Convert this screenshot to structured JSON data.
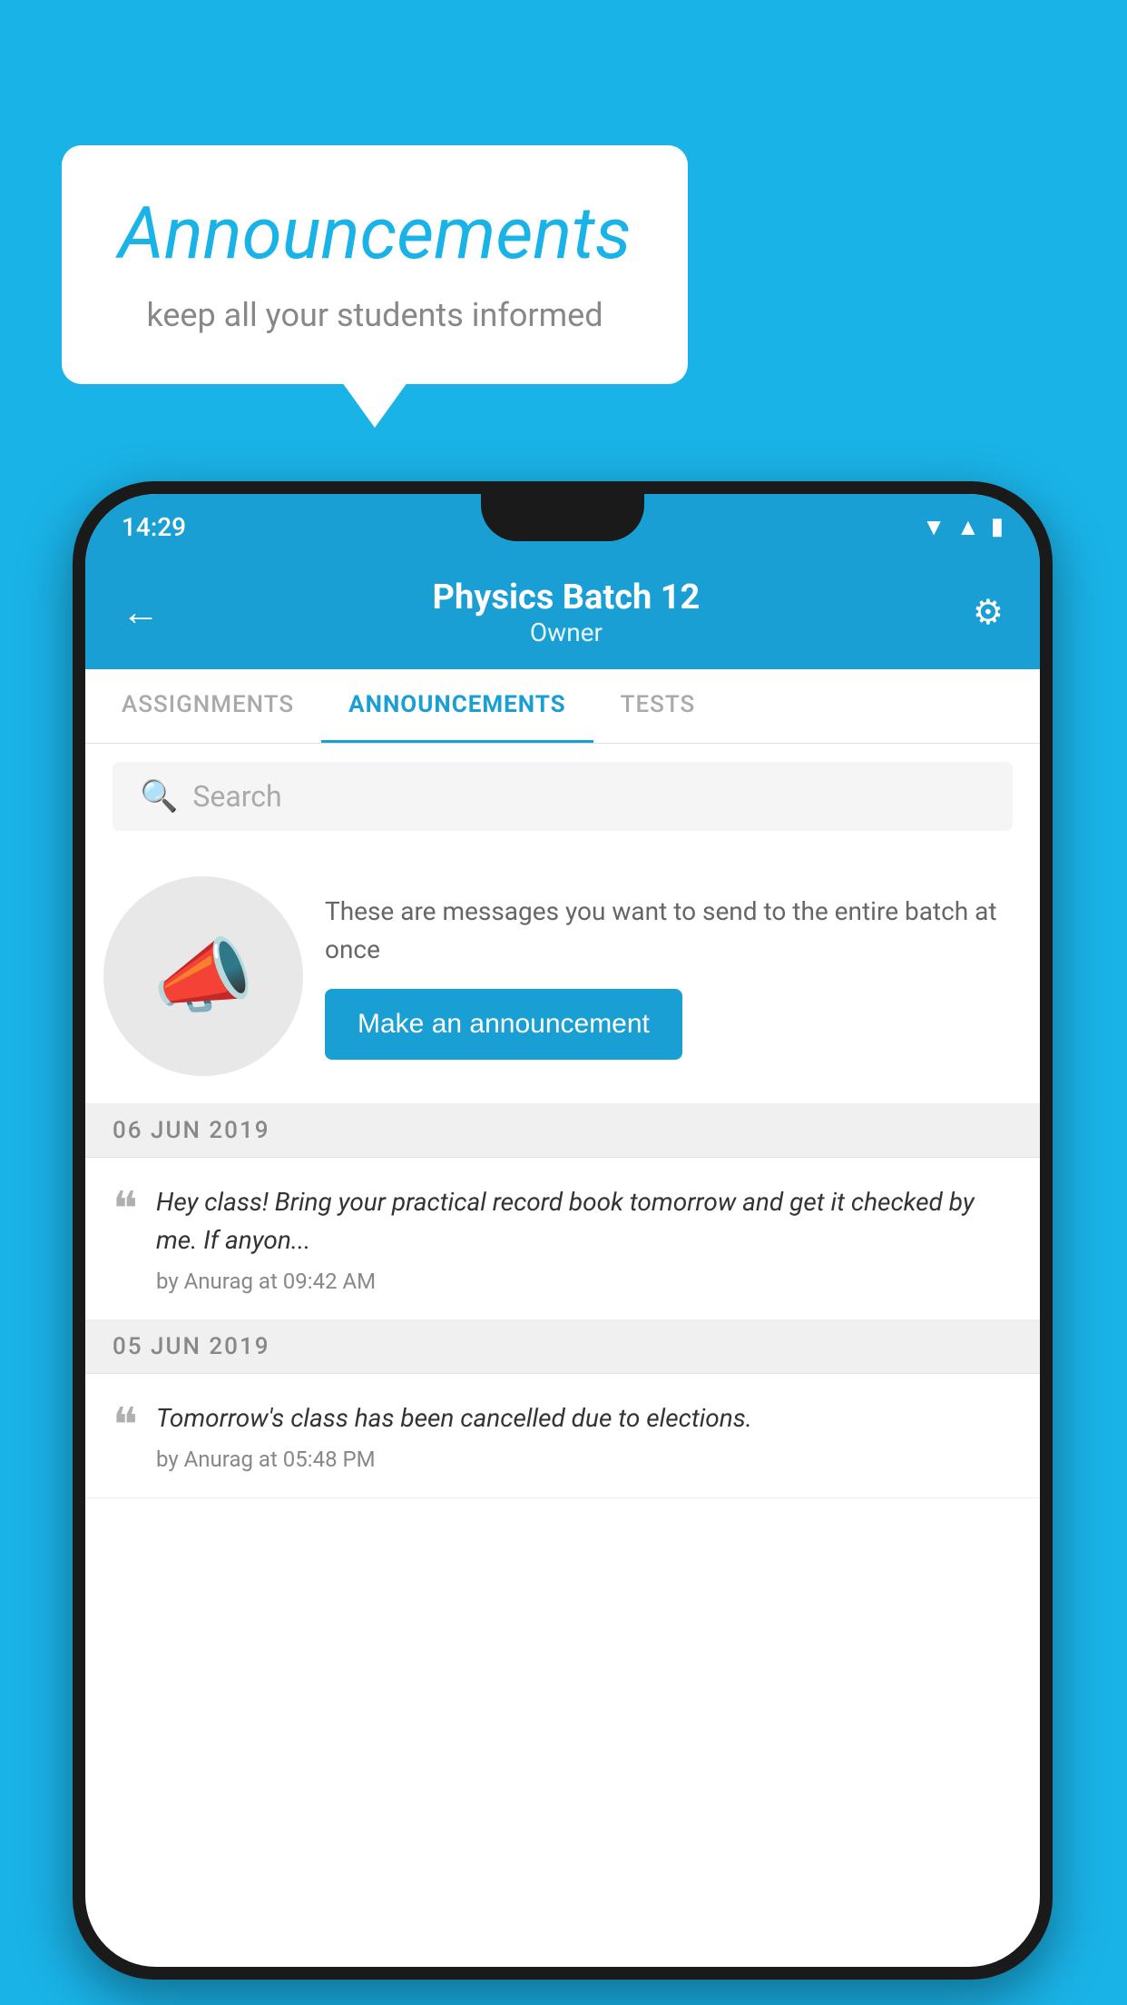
{
  "background_color": "#1ab3e8",
  "speech_bubble": {
    "title": "Announcements",
    "subtitle": "keep all your students informed"
  },
  "phone": {
    "status_bar": {
      "time": "14:29",
      "wifi": "▲",
      "signal": "▲",
      "battery": "▮"
    },
    "header": {
      "title": "Physics Batch 12",
      "subtitle": "Owner",
      "back_label": "←",
      "settings_label": "⚙"
    },
    "tabs": [
      {
        "label": "ASSIGNMENTS",
        "active": false
      },
      {
        "label": "ANNOUNCEMENTS",
        "active": true
      },
      {
        "label": "TESTS",
        "active": false
      }
    ],
    "search": {
      "placeholder": "Search"
    },
    "promo": {
      "description": "These are messages you want to send to the entire batch at once",
      "button_label": "Make an announcement"
    },
    "announcements": [
      {
        "date": "06  JUN  2019",
        "text": "Hey class! Bring your practical record book tomorrow and get it checked by me. If anyon...",
        "meta": "by Anurag at 09:42 AM"
      },
      {
        "date": "05  JUN  2019",
        "text": "Tomorrow's class has been cancelled due to elections.",
        "meta": "by Anurag at 05:48 PM"
      }
    ]
  }
}
